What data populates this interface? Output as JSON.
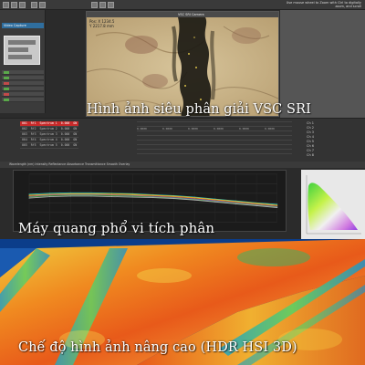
{
  "toolbar": {
    "status_text": "Use mouse wheel to Zoom with Ctrl to digitally zoom, and scroll"
  },
  "sidebar": {
    "header_label": "Video Capture"
  },
  "image_window": {
    "title": "VSC SRI Camera",
    "coordinates": "Pos: X 1234.5\nY 2217.8 mm"
  },
  "table": {
    "rows": [
      [
        "001",
        "Rf1",
        "Spectrum 1",
        "0.000",
        "ON"
      ],
      [
        "002",
        "Rf2",
        "Spectrum 2",
        "0.000",
        "ON"
      ],
      [
        "003",
        "Rf3",
        "Spectrum 3",
        "0.000",
        "ON"
      ],
      [
        "004",
        "Rf4",
        "Spectrum 4",
        "0.000",
        "ON"
      ],
      [
        "005",
        "Rf5",
        "Spectrum 5",
        "0.000",
        "ON"
      ]
    ],
    "selected_row": 0,
    "grid_values": [
      "0.0000",
      "0.0000",
      "0.0000",
      "0.0000",
      "0.0000",
      "0.0000"
    ],
    "channels": [
      "Ch 1",
      "Ch 2",
      "Ch 3",
      "Ch 4",
      "Ch 5",
      "Ch 6",
      "Ch 7",
      "Ch 8"
    ]
  },
  "chart_toolbar": {
    "text": "Wavelength (nm)  Intensity  Reflectance  Absorbance  Transmittance  Smooth  Overlay"
  },
  "captions": {
    "caption_1": "Hình ảnh siêu phân giải VSC SRI",
    "caption_2": "Máy quang phổ vi tích phân",
    "caption_3": "Chế độ hình ảnh nâng cao (HDR HSI 3D)"
  },
  "colors": {
    "selected_row": "#c82a2a",
    "series": [
      "#2ec4c4",
      "#e0c020",
      "#e08a30",
      "#8a5ad0",
      "#40a040",
      "#b0b0b0"
    ]
  },
  "chart_data": {
    "type": "line",
    "title": "",
    "xlabel": "",
    "ylabel": "",
    "x": [
      400,
      450,
      500,
      550,
      600,
      650,
      700,
      750,
      800,
      850,
      900,
      950,
      1000
    ],
    "ylim": [
      0,
      100
    ],
    "grid": true,
    "series": [
      {
        "values": [
          58,
          60,
          61,
          61,
          60,
          59,
          57,
          55,
          52,
          48,
          44,
          40,
          37
        ]
      },
      {
        "values": [
          56,
          58,
          59,
          59,
          59,
          58,
          56,
          54,
          51,
          47,
          43,
          39,
          35
        ]
      },
      {
        "values": [
          55,
          57,
          58,
          58,
          57,
          56,
          55,
          53,
          50,
          46,
          42,
          38,
          34
        ]
      },
      {
        "values": [
          53,
          56,
          57,
          57,
          56,
          55,
          53,
          51,
          48,
          44,
          40,
          36,
          32
        ]
      },
      {
        "values": [
          52,
          55,
          56,
          56,
          55,
          54,
          52,
          50,
          47,
          43,
          39,
          35,
          31
        ]
      },
      {
        "values": [
          50,
          53,
          54,
          54,
          53,
          52,
          51,
          49,
          46,
          42,
          38,
          34,
          30
        ]
      }
    ]
  }
}
